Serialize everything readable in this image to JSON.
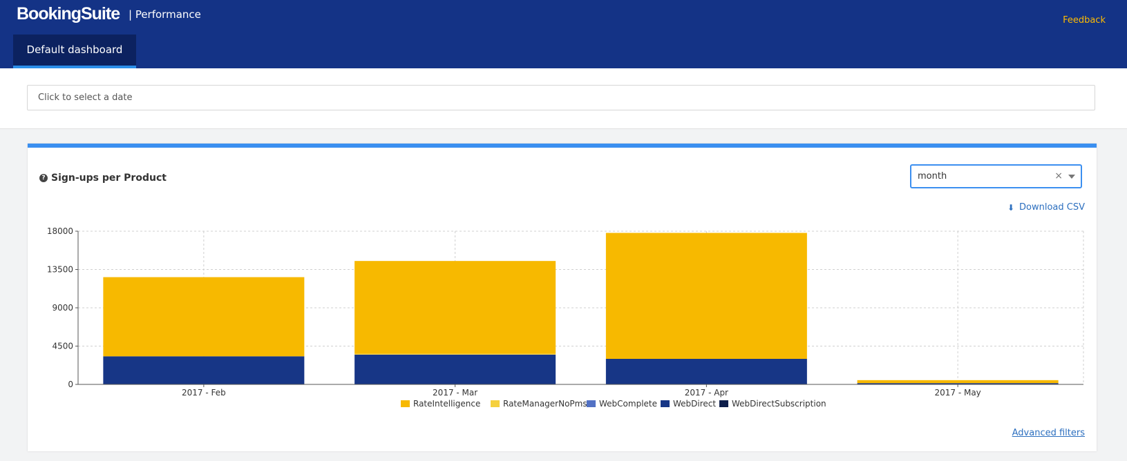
{
  "header": {
    "logo": "BookingSuite",
    "section": "| Performance",
    "feedback": "Feedback",
    "tab": "Default dashboard"
  },
  "date_filter": {
    "placeholder": "Click to select a date"
  },
  "card": {
    "title": "Sign-ups per Product",
    "period_select": "month",
    "download_label": "Download CSV",
    "advanced_filters": "Advanced filters"
  },
  "colors": {
    "RateIntelligence": "#f7b900",
    "RateManagerNoPms": "#f5d03d",
    "WebComplete": "#5271c4",
    "WebDirect": "#173686",
    "WebDirectSubscription": "#0d1e4a"
  },
  "chart_data": {
    "type": "bar",
    "stacked": true,
    "categories": [
      "2017 - Feb",
      "2017 - Mar",
      "2017 - Apr",
      "2017 - May"
    ],
    "series": [
      {
        "name": "RateIntelligence",
        "values": [
          9300,
          10900,
          14800,
          350
        ]
      },
      {
        "name": "RateManagerNoPms",
        "values": [
          0,
          100,
          0,
          0
        ]
      },
      {
        "name": "WebComplete",
        "values": [
          0,
          0,
          0,
          0
        ]
      },
      {
        "name": "WebDirect",
        "values": [
          3300,
          3500,
          3000,
          150
        ]
      },
      {
        "name": "WebDirectSubscription",
        "values": [
          0,
          0,
          0,
          0
        ]
      }
    ],
    "yticks": [
      "0",
      "4500",
      "9000",
      "13500",
      "18000"
    ],
    "ylim": [
      0,
      18000
    ],
    "grid": true,
    "legend": "bottom"
  }
}
